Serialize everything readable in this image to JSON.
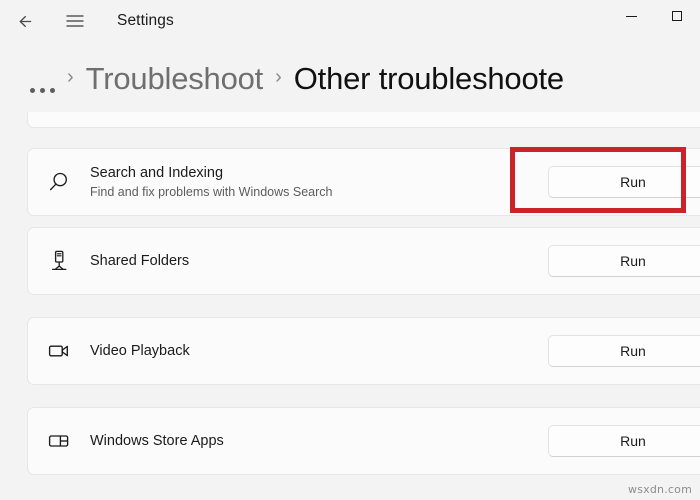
{
  "titlebar": {
    "back_label": "Back",
    "menu_label": "Navigation menu",
    "app_title": "Settings",
    "minimize_label": "Minimize",
    "maximize_label": "Maximize"
  },
  "breadcrumb": {
    "overflow_label": "...",
    "separator": "›",
    "parent": "Troubleshoot",
    "current": "Other troubleshoote"
  },
  "troubleshooters": [
    {
      "icon": "search-icon",
      "title": "Search and Indexing",
      "subtitle": "Find and fix problems with Windows Search",
      "action_label": "Run",
      "highlighted": true
    },
    {
      "icon": "shared-folders-icon",
      "title": "Shared Folders",
      "subtitle": "",
      "action_label": "Run",
      "highlighted": false
    },
    {
      "icon": "video-camera-icon",
      "title": "Video Playback",
      "subtitle": "",
      "action_label": "Run",
      "highlighted": false
    },
    {
      "icon": "store-apps-icon",
      "title": "Windows Store Apps",
      "subtitle": "",
      "action_label": "Run",
      "highlighted": false
    }
  ],
  "annotation": {
    "color": "#cc2229",
    "target": "Run button for Search and Indexing"
  },
  "watermark": {
    "text": "wsxdn.com"
  },
  "colors": {
    "page_background": "#f3f3f3",
    "card_background": "#fbfbfb",
    "text_primary": "#1b1b1b",
    "text_secondary": "#5d5d5d",
    "breadcrumb_parent": "#6f6f6f",
    "annotation_red": "#cc2229"
  }
}
